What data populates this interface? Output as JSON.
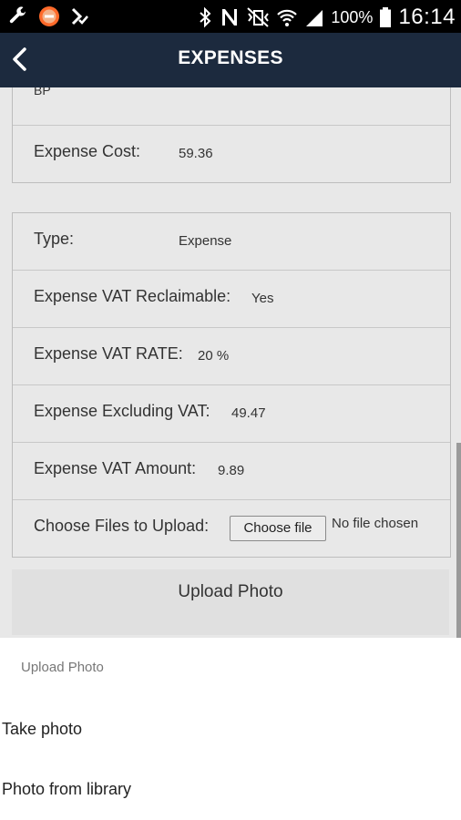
{
  "status_bar": {
    "battery_percent": "100%",
    "time": "16:14",
    "icons_left": [
      "wrench-icon",
      "stop-circle-icon",
      "download-check-icon"
    ],
    "icons_right": [
      "bluetooth-icon",
      "nfc-icon",
      "vibrate-mute-icon",
      "wifi-icon",
      "signal-icon",
      "battery-icon"
    ]
  },
  "app_bar": {
    "title": "EXPENSES"
  },
  "card1": {
    "partial_value": "BP",
    "expense_cost_label": "Expense Cost:",
    "expense_cost_value": "59.36"
  },
  "card2": {
    "rows": [
      {
        "label": "Type:",
        "value": "Expense"
      },
      {
        "label": "Expense VAT Reclaimable:",
        "value": "Yes"
      },
      {
        "label": "Expense VAT RATE:",
        "value": "20 %"
      },
      {
        "label": "Expense Excluding VAT:",
        "value": "49.47"
      },
      {
        "label": "Expense VAT Amount:",
        "value": "9.89"
      }
    ],
    "upload_row": {
      "label": "Choose Files to Upload:",
      "button": "Choose file",
      "status": "No file chosen"
    }
  },
  "upload_button": "Upload Photo",
  "sheet": {
    "title": "Upload Photo",
    "items": [
      "Take photo",
      "Photo from library"
    ]
  },
  "colors": {
    "app_bar": "#1c2a3e",
    "status_bar": "#000000",
    "page_bg": "#e8e8e8",
    "sheet_bg": "#ffffff"
  }
}
